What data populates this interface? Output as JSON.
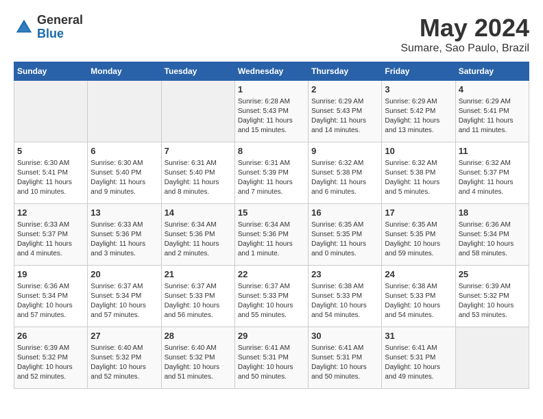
{
  "header": {
    "logo_general": "General",
    "logo_blue": "Blue",
    "title": "May 2024",
    "subtitle": "Sumare, Sao Paulo, Brazil"
  },
  "weekdays": [
    "Sunday",
    "Monday",
    "Tuesday",
    "Wednesday",
    "Thursday",
    "Friday",
    "Saturday"
  ],
  "weeks": [
    [
      {
        "day": "",
        "info": ""
      },
      {
        "day": "",
        "info": ""
      },
      {
        "day": "",
        "info": ""
      },
      {
        "day": "1",
        "info": "Sunrise: 6:28 AM\nSunset: 5:43 PM\nDaylight: 11 hours\nand 15 minutes."
      },
      {
        "day": "2",
        "info": "Sunrise: 6:29 AM\nSunset: 5:43 PM\nDaylight: 11 hours\nand 14 minutes."
      },
      {
        "day": "3",
        "info": "Sunrise: 6:29 AM\nSunset: 5:42 PM\nDaylight: 11 hours\nand 13 minutes."
      },
      {
        "day": "4",
        "info": "Sunrise: 6:29 AM\nSunset: 5:41 PM\nDaylight: 11 hours\nand 11 minutes."
      }
    ],
    [
      {
        "day": "5",
        "info": "Sunrise: 6:30 AM\nSunset: 5:41 PM\nDaylight: 11 hours\nand 10 minutes."
      },
      {
        "day": "6",
        "info": "Sunrise: 6:30 AM\nSunset: 5:40 PM\nDaylight: 11 hours\nand 9 minutes."
      },
      {
        "day": "7",
        "info": "Sunrise: 6:31 AM\nSunset: 5:40 PM\nDaylight: 11 hours\nand 8 minutes."
      },
      {
        "day": "8",
        "info": "Sunrise: 6:31 AM\nSunset: 5:39 PM\nDaylight: 11 hours\nand 7 minutes."
      },
      {
        "day": "9",
        "info": "Sunrise: 6:32 AM\nSunset: 5:38 PM\nDaylight: 11 hours\nand 6 minutes."
      },
      {
        "day": "10",
        "info": "Sunrise: 6:32 AM\nSunset: 5:38 PM\nDaylight: 11 hours\nand 5 minutes."
      },
      {
        "day": "11",
        "info": "Sunrise: 6:32 AM\nSunset: 5:37 PM\nDaylight: 11 hours\nand 4 minutes."
      }
    ],
    [
      {
        "day": "12",
        "info": "Sunrise: 6:33 AM\nSunset: 5:37 PM\nDaylight: 11 hours\nand 4 minutes."
      },
      {
        "day": "13",
        "info": "Sunrise: 6:33 AM\nSunset: 5:36 PM\nDaylight: 11 hours\nand 3 minutes."
      },
      {
        "day": "14",
        "info": "Sunrise: 6:34 AM\nSunset: 5:36 PM\nDaylight: 11 hours\nand 2 minutes."
      },
      {
        "day": "15",
        "info": "Sunrise: 6:34 AM\nSunset: 5:36 PM\nDaylight: 11 hours\nand 1 minute."
      },
      {
        "day": "16",
        "info": "Sunrise: 6:35 AM\nSunset: 5:35 PM\nDaylight: 11 hours\nand 0 minutes."
      },
      {
        "day": "17",
        "info": "Sunrise: 6:35 AM\nSunset: 5:35 PM\nDaylight: 10 hours\nand 59 minutes."
      },
      {
        "day": "18",
        "info": "Sunrise: 6:36 AM\nSunset: 5:34 PM\nDaylight: 10 hours\nand 58 minutes."
      }
    ],
    [
      {
        "day": "19",
        "info": "Sunrise: 6:36 AM\nSunset: 5:34 PM\nDaylight: 10 hours\nand 57 minutes."
      },
      {
        "day": "20",
        "info": "Sunrise: 6:37 AM\nSunset: 5:34 PM\nDaylight: 10 hours\nand 57 minutes."
      },
      {
        "day": "21",
        "info": "Sunrise: 6:37 AM\nSunset: 5:33 PM\nDaylight: 10 hours\nand 56 minutes."
      },
      {
        "day": "22",
        "info": "Sunrise: 6:37 AM\nSunset: 5:33 PM\nDaylight: 10 hours\nand 55 minutes."
      },
      {
        "day": "23",
        "info": "Sunrise: 6:38 AM\nSunset: 5:33 PM\nDaylight: 10 hours\nand 54 minutes."
      },
      {
        "day": "24",
        "info": "Sunrise: 6:38 AM\nSunset: 5:33 PM\nDaylight: 10 hours\nand 54 minutes."
      },
      {
        "day": "25",
        "info": "Sunrise: 6:39 AM\nSunset: 5:32 PM\nDaylight: 10 hours\nand 53 minutes."
      }
    ],
    [
      {
        "day": "26",
        "info": "Sunrise: 6:39 AM\nSunset: 5:32 PM\nDaylight: 10 hours\nand 52 minutes."
      },
      {
        "day": "27",
        "info": "Sunrise: 6:40 AM\nSunset: 5:32 PM\nDaylight: 10 hours\nand 52 minutes."
      },
      {
        "day": "28",
        "info": "Sunrise: 6:40 AM\nSunset: 5:32 PM\nDaylight: 10 hours\nand 51 minutes."
      },
      {
        "day": "29",
        "info": "Sunrise: 6:41 AM\nSunset: 5:31 PM\nDaylight: 10 hours\nand 50 minutes."
      },
      {
        "day": "30",
        "info": "Sunrise: 6:41 AM\nSunset: 5:31 PM\nDaylight: 10 hours\nand 50 minutes."
      },
      {
        "day": "31",
        "info": "Sunrise: 6:41 AM\nSunset: 5:31 PM\nDaylight: 10 hours\nand 49 minutes."
      },
      {
        "day": "",
        "info": ""
      }
    ]
  ]
}
